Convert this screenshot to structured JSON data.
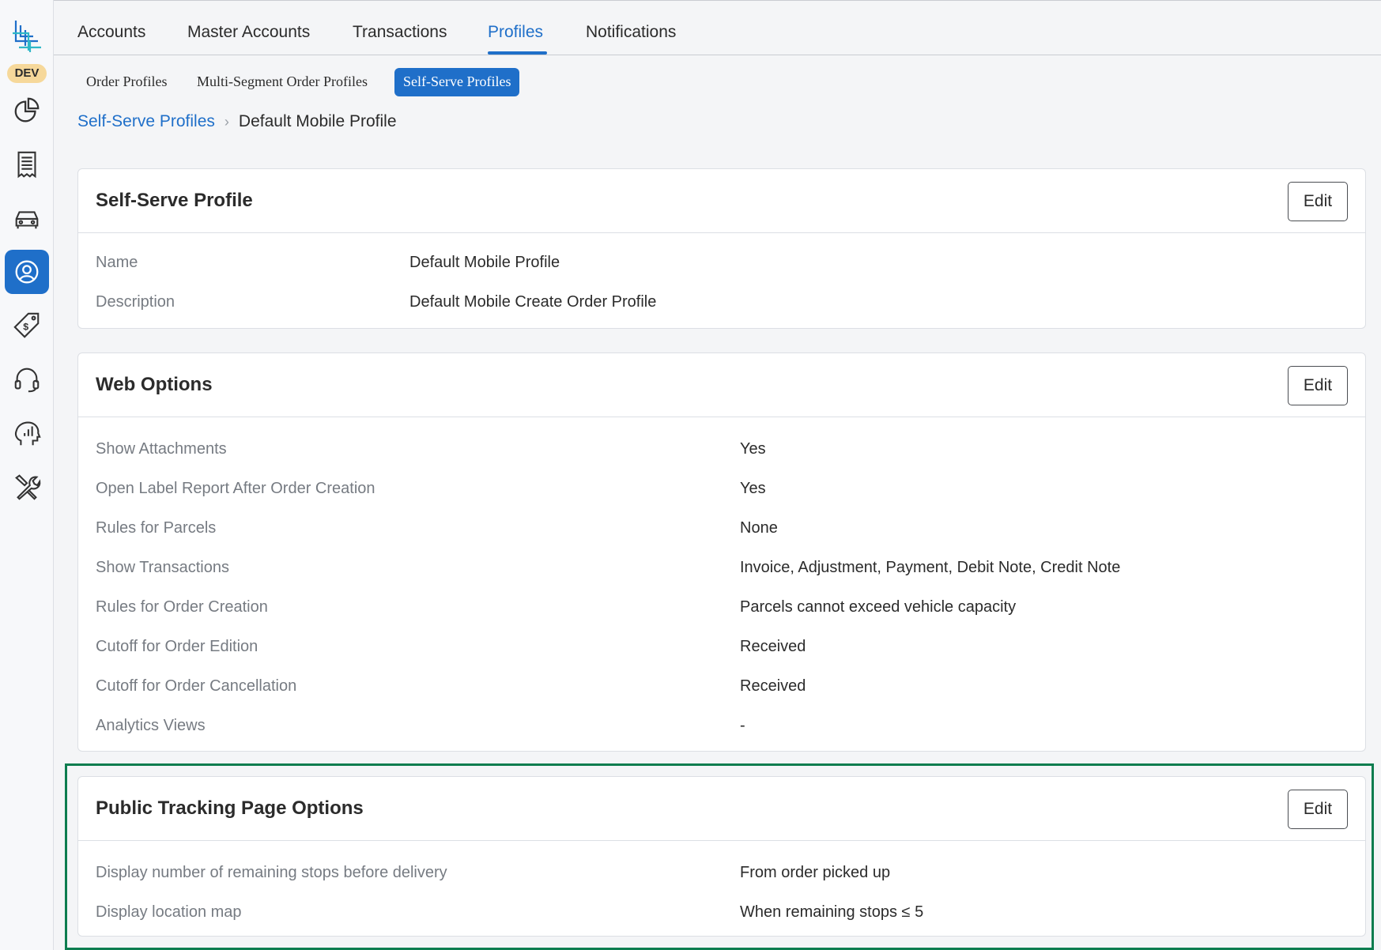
{
  "app": {
    "env_badge": "DEV"
  },
  "sidebar": {
    "items": [
      {
        "icon": "reports-pie-icon",
        "active": false
      },
      {
        "icon": "receipt-icon",
        "active": false
      },
      {
        "icon": "vehicle-icon",
        "active": false
      },
      {
        "icon": "user-circle-icon",
        "active": true
      },
      {
        "icon": "price-tag-icon",
        "active": false
      },
      {
        "icon": "headset-icon",
        "active": false
      },
      {
        "icon": "analytics-head-icon",
        "active": false
      },
      {
        "icon": "tools-icon",
        "active": false
      }
    ]
  },
  "topnav": {
    "tabs": [
      "Accounts",
      "Master Accounts",
      "Transactions",
      "Profiles",
      "Notifications"
    ],
    "active": "Profiles"
  },
  "subtabs": {
    "items": [
      "Order Profiles",
      "Multi-Segment Order Profiles",
      "Self-Serve Profiles"
    ],
    "active": "Self-Serve Profiles"
  },
  "breadcrumb": {
    "parent": "Self-Serve Profiles",
    "current": "Default Mobile Profile"
  },
  "cards": [
    {
      "title": "Self-Serve Profile",
      "edit_label": "Edit",
      "rows": [
        {
          "label": "Name",
          "value": "Default Mobile Profile"
        },
        {
          "label": "Description",
          "value": "Default Mobile Create Order Profile"
        }
      ]
    },
    {
      "title": "Web Options",
      "edit_label": "Edit",
      "rows": [
        {
          "label": "Show Attachments",
          "value": "Yes"
        },
        {
          "label": "Open Label Report After Order Creation",
          "value": "Yes"
        },
        {
          "label": "Rules for Parcels",
          "value": "None"
        },
        {
          "label": "Show Transactions",
          "value": "Invoice, Adjustment, Payment, Debit Note, Credit Note"
        },
        {
          "label": "Rules for Order Creation",
          "value": "Parcels cannot exceed vehicle capacity"
        },
        {
          "label": "Cutoff for Order Edition",
          "value": "Received"
        },
        {
          "label": "Cutoff for Order Cancellation",
          "value": "Received"
        },
        {
          "label": "Analytics Views",
          "value": "-"
        }
      ]
    },
    {
      "title": "Public Tracking Page Options",
      "edit_label": "Edit",
      "rows": [
        {
          "label": "Display number of remaining stops before delivery",
          "value": "From order picked up"
        },
        {
          "label": "Display location map",
          "value": "When remaining stops ≤ 5"
        }
      ]
    }
  ],
  "colors": {
    "accent": "#1f6fc9",
    "highlight_border": "#0d7d4f",
    "env_badge_bg": "#f6d89a"
  }
}
